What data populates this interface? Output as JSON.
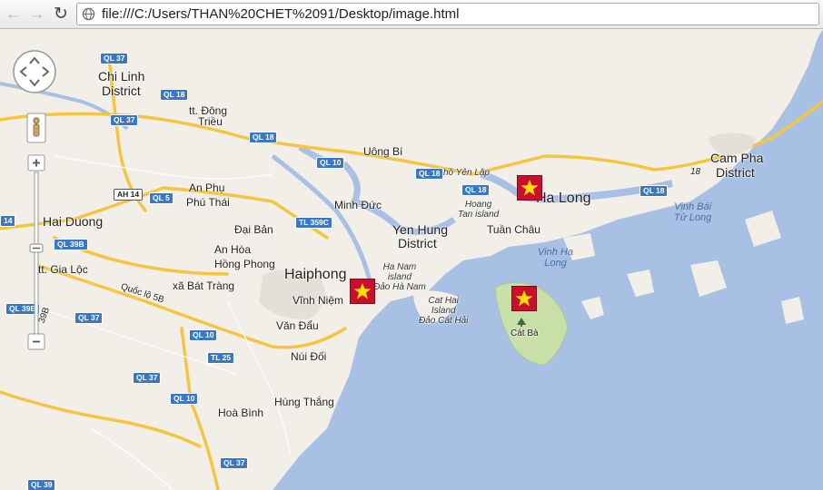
{
  "browser": {
    "url": "file:///C:/Users/THAN%20CHET%2091/Desktop/image.html"
  },
  "map": {
    "places": {
      "chi_linh_1": "Chi Linh",
      "chi_linh_2": "District",
      "dong_trieu_1": "tt. Đông",
      "dong_trieu_2": "Triều",
      "uong_bi": "Uông Bí",
      "an_phu": "An Phụ",
      "phu_thai": "Phú Thái",
      "hai_duong": "Hai Duong",
      "dai_ban": "Đại Bản",
      "an_hoa": "An Hòa",
      "hong_phong": "Hồng Phong",
      "gia_loc": "tt. Gia Lộc",
      "bat_trang": "xã Bát Tràng",
      "haiphong": "Haiphong",
      "vinh_niem": "Vĩnh Niệm",
      "van_dau": "Văn Đẩu",
      "nui_doi": "Núi Đối",
      "hung_thang": "Hùng Thắng",
      "hoa_binh": "Hoà Bình",
      "minh_duc": "Minh Đức",
      "yen_hung_1": "Yen Hung",
      "yen_hung_2": "District",
      "ha_long": "Ha Long",
      "tuan_chau": "Tuần Châu",
      "cam_pha_1": "Cam Pha",
      "cam_pha_2": "District",
      "cat_ba": "Cát Bà",
      "ho_yen_lap": "hồ Yên Lập"
    },
    "water": {
      "vinh_ha_long_1": "Vinh Ha",
      "vinh_ha_long_2": "Long",
      "bai_tu_long_1": "Vịnh Bái",
      "bai_tu_long_2": "Tử Long"
    },
    "islands": {
      "hoang_tan_1": "Hoang",
      "hoang_tan_2": "Tan island",
      "ha_nam_1": "Ha Nam",
      "ha_nam_2": "island",
      "ha_nam_3": "Đảo Hà Nam",
      "cat_hai_1": "Cat Hai",
      "cat_hai_2": "Island",
      "cat_hai_3": "Đảo Cát Hải"
    },
    "roads": [
      "QL 37",
      "QL 18",
      "QL 37",
      "QL 18",
      "QL 10",
      "QL 18",
      "QL 18",
      "QL 18",
      "AH 14",
      "QL 5",
      "TL 359C",
      "QL 39B",
      "QL 37",
      "QL 10",
      "TL 25",
      "QL 37",
      "QL 10",
      "QL 37",
      "QL 39",
      "14",
      "QL 39B",
      "18"
    ],
    "road_labels": {
      "quoc_lo_5b": "Quốc lộ 5B",
      "r39b": "39B"
    },
    "markers_count": 3
  }
}
